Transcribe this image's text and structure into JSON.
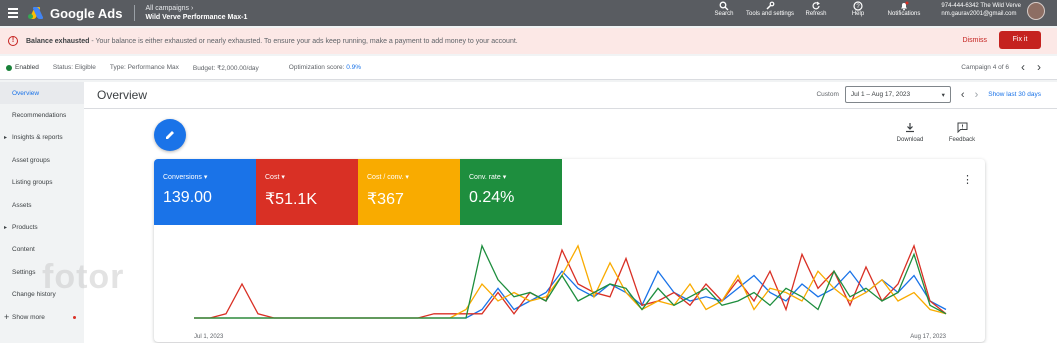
{
  "topbar": {
    "app_title": "Google Ads",
    "crumb_small": "All campaigns",
    "crumb_big": "Wild Verve Performance Max-1",
    "tools": [
      {
        "label": "Search",
        "icon": "search-icon"
      },
      {
        "label": "Tools and settings",
        "icon": "wrench-icon"
      },
      {
        "label": "Refresh",
        "icon": "refresh-icon"
      },
      {
        "label": "Help",
        "icon": "help-icon"
      },
      {
        "label": "Notifications",
        "icon": "bell-icon"
      }
    ],
    "account_line1": "974-444-6342 The Wild Verve",
    "account_line2": "nm.gaurav2001@gmail.com"
  },
  "alert": {
    "title": "Balance exhausted",
    "message": " - Your balance is either exhausted or nearly exhausted. To ensure your ads keep running, make a payment to add money to your account.",
    "dismiss": "Dismiss",
    "fix": "Fix it"
  },
  "status": {
    "enabled": "Enabled",
    "status": "Status: Eligible",
    "type": "Type: Performance Max",
    "budget": "Budget: ₹2,000.00/day",
    "opt_label": "Optimization score:",
    "opt_value": "0.9%",
    "campaign_of": "Campaign 4 of 6"
  },
  "sidebar": {
    "items": [
      {
        "label": "Overview"
      },
      {
        "label": "Recommendations"
      },
      {
        "label": "Insights & reports"
      },
      {
        "label": "Asset groups"
      },
      {
        "label": "Listing groups"
      },
      {
        "label": "Assets"
      },
      {
        "label": "Products"
      },
      {
        "label": "Content"
      },
      {
        "label": "Settings"
      },
      {
        "label": "Change history"
      },
      {
        "label": "Show more"
      }
    ]
  },
  "main": {
    "title": "Overview",
    "custom_label": "Custom",
    "date_range": "Jul 1 – Aug 17, 2023",
    "show_last": "Show last 30 days",
    "download": "Download",
    "feedback": "Feedback"
  },
  "metrics": [
    {
      "name": "Conversions",
      "value": "139.00",
      "color": "#1a73e8"
    },
    {
      "name": "Cost",
      "value": "₹51.1K",
      "color": "#d93025"
    },
    {
      "name": "Cost / conv.",
      "value": "₹367",
      "color": "#f9ab00"
    },
    {
      "name": "Conv. rate",
      "value": "0.24%",
      "color": "#1e8e3e"
    }
  ],
  "chart_data": {
    "type": "line",
    "x_start_label": "Jul 1, 2023",
    "x_end_label": "Aug 17, 2023",
    "series": [
      {
        "name": "Conversions",
        "color": "#1a73e8",
        "values": [
          0,
          0,
          0,
          0,
          0,
          0,
          0,
          0,
          0,
          0,
          0,
          0,
          0,
          0,
          0,
          0,
          0,
          0,
          0.1,
          0.35,
          0.1,
          0.2,
          0.3,
          0.55,
          0.35,
          0.25,
          0.4,
          0.3,
          0.15,
          0.55,
          0.3,
          0.2,
          0.25,
          0.2,
          0.35,
          0.5,
          0.3,
          0.2,
          0.4,
          0.25,
          0.35,
          0.55,
          0.3,
          0.45,
          0.3,
          0.5,
          0.2,
          0.1
        ]
      },
      {
        "name": "Cost",
        "color": "#d93025",
        "values": [
          0,
          0,
          0.05,
          0.4,
          0.05,
          0,
          0,
          0,
          0,
          0,
          0,
          0,
          0,
          0,
          0,
          0.05,
          0.05,
          0.05,
          0.05,
          0.3,
          0.05,
          0.3,
          0.2,
          0.8,
          0.4,
          0.3,
          0.25,
          0.7,
          0.15,
          0.2,
          0.3,
          0.15,
          0.4,
          0.2,
          0.45,
          0.2,
          0.55,
          0.1,
          0.75,
          0.35,
          0.55,
          0.15,
          0.6,
          0.2,
          0.4,
          0.85,
          0.2,
          0.05
        ]
      },
      {
        "name": "Cost / conv.",
        "color": "#f9ab00",
        "values": [
          0,
          0,
          0,
          0,
          0,
          0,
          0,
          0,
          0,
          0,
          0,
          0,
          0,
          0,
          0,
          0,
          0,
          0.1,
          0.4,
          0.2,
          0.3,
          0.2,
          0.25,
          0.5,
          0.85,
          0.25,
          0.65,
          0.3,
          0.1,
          0.2,
          0.15,
          0.4,
          0.1,
          0.2,
          0.5,
          0.1,
          0.35,
          0.3,
          0.2,
          0.55,
          0.35,
          0.2,
          0.3,
          0.45,
          0.2,
          0.3,
          0.1,
          0.05
        ]
      },
      {
        "name": "Conv. rate",
        "color": "#1e8e3e",
        "values": [
          0,
          0,
          0,
          0,
          0,
          0,
          0,
          0,
          0,
          0,
          0,
          0,
          0,
          0,
          0,
          0,
          0,
          0,
          0.85,
          0.45,
          0.25,
          0.3,
          0.2,
          0.5,
          0.2,
          0.3,
          0.4,
          0.35,
          0.1,
          0.35,
          0.15,
          0.25,
          0.35,
          0.15,
          0.2,
          0.3,
          0.15,
          0.35,
          0.25,
          0.1,
          0.55,
          0.25,
          0.35,
          0.2,
          0.3,
          0.75,
          0.15,
          0.05
        ]
      }
    ]
  }
}
